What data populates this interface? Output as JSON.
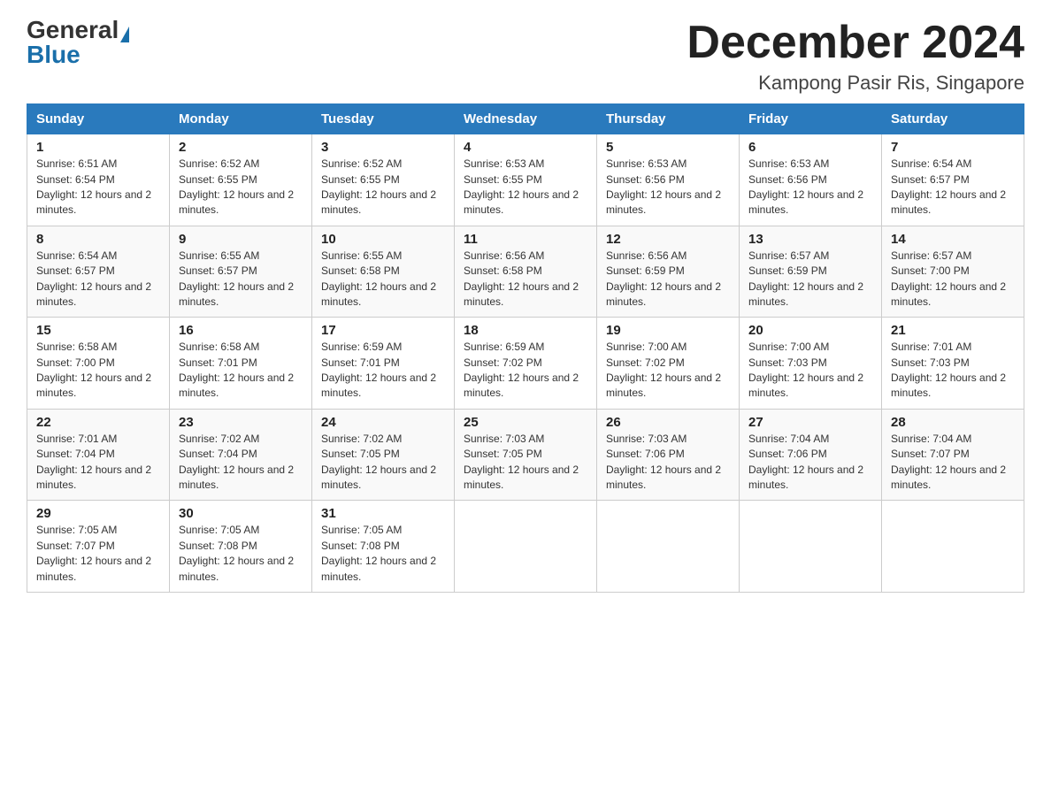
{
  "header": {
    "logo_general": "General",
    "logo_blue": "Blue",
    "month_title": "December 2024",
    "location": "Kampong Pasir Ris, Singapore"
  },
  "weekdays": [
    "Sunday",
    "Monday",
    "Tuesday",
    "Wednesday",
    "Thursday",
    "Friday",
    "Saturday"
  ],
  "weeks": [
    [
      {
        "day": "1",
        "sunrise": "6:51 AM",
        "sunset": "6:54 PM",
        "daylight": "12 hours and 2 minutes."
      },
      {
        "day": "2",
        "sunrise": "6:52 AM",
        "sunset": "6:55 PM",
        "daylight": "12 hours and 2 minutes."
      },
      {
        "day": "3",
        "sunrise": "6:52 AM",
        "sunset": "6:55 PM",
        "daylight": "12 hours and 2 minutes."
      },
      {
        "day": "4",
        "sunrise": "6:53 AM",
        "sunset": "6:55 PM",
        "daylight": "12 hours and 2 minutes."
      },
      {
        "day": "5",
        "sunrise": "6:53 AM",
        "sunset": "6:56 PM",
        "daylight": "12 hours and 2 minutes."
      },
      {
        "day": "6",
        "sunrise": "6:53 AM",
        "sunset": "6:56 PM",
        "daylight": "12 hours and 2 minutes."
      },
      {
        "day": "7",
        "sunrise": "6:54 AM",
        "sunset": "6:57 PM",
        "daylight": "12 hours and 2 minutes."
      }
    ],
    [
      {
        "day": "8",
        "sunrise": "6:54 AM",
        "sunset": "6:57 PM",
        "daylight": "12 hours and 2 minutes."
      },
      {
        "day": "9",
        "sunrise": "6:55 AM",
        "sunset": "6:57 PM",
        "daylight": "12 hours and 2 minutes."
      },
      {
        "day": "10",
        "sunrise": "6:55 AM",
        "sunset": "6:58 PM",
        "daylight": "12 hours and 2 minutes."
      },
      {
        "day": "11",
        "sunrise": "6:56 AM",
        "sunset": "6:58 PM",
        "daylight": "12 hours and 2 minutes."
      },
      {
        "day": "12",
        "sunrise": "6:56 AM",
        "sunset": "6:59 PM",
        "daylight": "12 hours and 2 minutes."
      },
      {
        "day": "13",
        "sunrise": "6:57 AM",
        "sunset": "6:59 PM",
        "daylight": "12 hours and 2 minutes."
      },
      {
        "day": "14",
        "sunrise": "6:57 AM",
        "sunset": "7:00 PM",
        "daylight": "12 hours and 2 minutes."
      }
    ],
    [
      {
        "day": "15",
        "sunrise": "6:58 AM",
        "sunset": "7:00 PM",
        "daylight": "12 hours and 2 minutes."
      },
      {
        "day": "16",
        "sunrise": "6:58 AM",
        "sunset": "7:01 PM",
        "daylight": "12 hours and 2 minutes."
      },
      {
        "day": "17",
        "sunrise": "6:59 AM",
        "sunset": "7:01 PM",
        "daylight": "12 hours and 2 minutes."
      },
      {
        "day": "18",
        "sunrise": "6:59 AM",
        "sunset": "7:02 PM",
        "daylight": "12 hours and 2 minutes."
      },
      {
        "day": "19",
        "sunrise": "7:00 AM",
        "sunset": "7:02 PM",
        "daylight": "12 hours and 2 minutes."
      },
      {
        "day": "20",
        "sunrise": "7:00 AM",
        "sunset": "7:03 PM",
        "daylight": "12 hours and 2 minutes."
      },
      {
        "day": "21",
        "sunrise": "7:01 AM",
        "sunset": "7:03 PM",
        "daylight": "12 hours and 2 minutes."
      }
    ],
    [
      {
        "day": "22",
        "sunrise": "7:01 AM",
        "sunset": "7:04 PM",
        "daylight": "12 hours and 2 minutes."
      },
      {
        "day": "23",
        "sunrise": "7:02 AM",
        "sunset": "7:04 PM",
        "daylight": "12 hours and 2 minutes."
      },
      {
        "day": "24",
        "sunrise": "7:02 AM",
        "sunset": "7:05 PM",
        "daylight": "12 hours and 2 minutes."
      },
      {
        "day": "25",
        "sunrise": "7:03 AM",
        "sunset": "7:05 PM",
        "daylight": "12 hours and 2 minutes."
      },
      {
        "day": "26",
        "sunrise": "7:03 AM",
        "sunset": "7:06 PM",
        "daylight": "12 hours and 2 minutes."
      },
      {
        "day": "27",
        "sunrise": "7:04 AM",
        "sunset": "7:06 PM",
        "daylight": "12 hours and 2 minutes."
      },
      {
        "day": "28",
        "sunrise": "7:04 AM",
        "sunset": "7:07 PM",
        "daylight": "12 hours and 2 minutes."
      }
    ],
    [
      {
        "day": "29",
        "sunrise": "7:05 AM",
        "sunset": "7:07 PM",
        "daylight": "12 hours and 2 minutes."
      },
      {
        "day": "30",
        "sunrise": "7:05 AM",
        "sunset": "7:08 PM",
        "daylight": "12 hours and 2 minutes."
      },
      {
        "day": "31",
        "sunrise": "7:05 AM",
        "sunset": "7:08 PM",
        "daylight": "12 hours and 2 minutes."
      },
      null,
      null,
      null,
      null
    ]
  ]
}
